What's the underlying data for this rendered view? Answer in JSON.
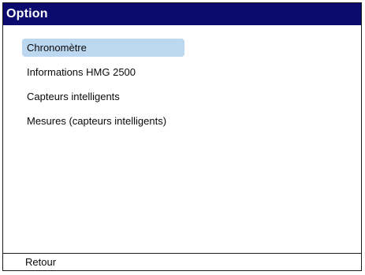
{
  "window": {
    "title": "Option"
  },
  "menu": {
    "items": [
      {
        "label": "Chronomètre",
        "selected": true
      },
      {
        "label": "Informations HMG 2500",
        "selected": false
      },
      {
        "label": "Capteurs intelligents",
        "selected": false
      },
      {
        "label": "Mesures (capteurs intelligents)",
        "selected": false
      }
    ]
  },
  "footer": {
    "back_label": "Retour"
  },
  "colors": {
    "titlebar": "#0b0b6e",
    "selection": "#bcd7f0",
    "text": "#0a0a0a"
  }
}
